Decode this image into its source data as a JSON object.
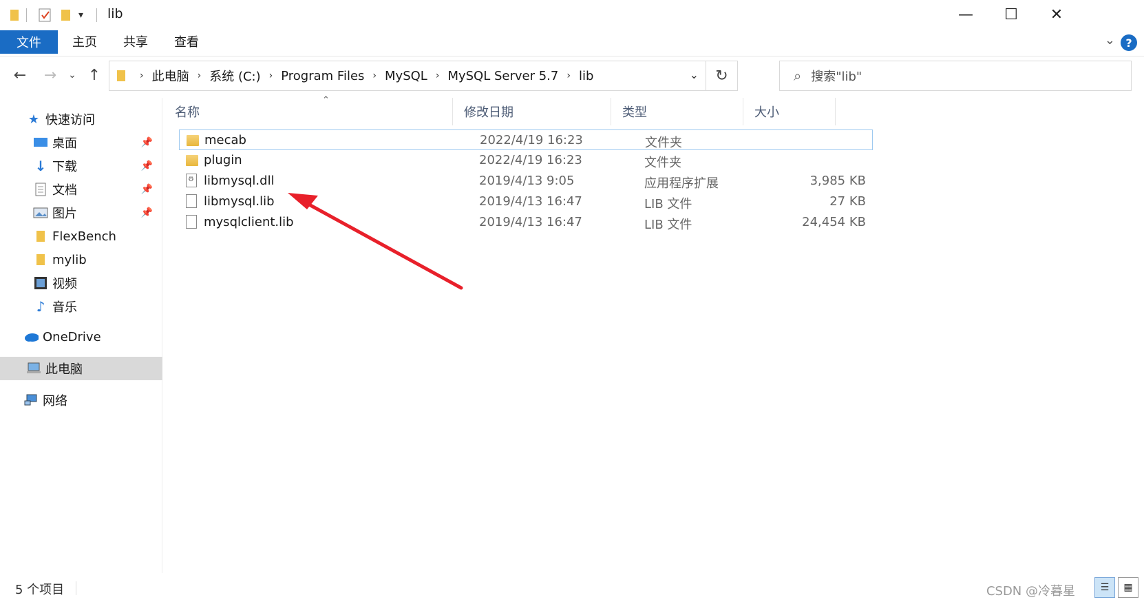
{
  "window": {
    "title": "lib",
    "controls": {
      "minimize": "—",
      "maximize": "☐",
      "close": "✕"
    }
  },
  "ribbon": {
    "tabs": [
      "文件",
      "主页",
      "共享",
      "查看"
    ],
    "help": "?"
  },
  "address": {
    "crumbs": [
      "此电脑",
      "系统 (C:)",
      "Program Files",
      "MySQL",
      "MySQL Server 5.7",
      "lib"
    ],
    "search_placeholder": "搜索\"lib\""
  },
  "sidebar": {
    "quick_access": "快速访问",
    "items": [
      {
        "label": "桌面",
        "icon": "desktop-icon",
        "pinned": true
      },
      {
        "label": "下载",
        "icon": "download-icon",
        "pinned": true
      },
      {
        "label": "文档",
        "icon": "document-icon",
        "pinned": true
      },
      {
        "label": "图片",
        "icon": "picture-icon",
        "pinned": true
      },
      {
        "label": "FlexBench",
        "icon": "folder-icon",
        "pinned": false
      },
      {
        "label": "mylib",
        "icon": "folder-icon",
        "pinned": false
      },
      {
        "label": "视频",
        "icon": "video-icon",
        "pinned": false
      },
      {
        "label": "音乐",
        "icon": "music-icon",
        "pinned": false
      }
    ],
    "onedrive": "OneDrive",
    "this_pc": "此电脑",
    "network": "网络"
  },
  "columns": {
    "name": "名称",
    "modified": "修改日期",
    "type": "类型",
    "size": "大小"
  },
  "files": [
    {
      "name": "mecab",
      "modified": "2022/4/19 16:23",
      "type": "文件夹",
      "size": "",
      "kind": "folder"
    },
    {
      "name": "plugin",
      "modified": "2022/4/19 16:23",
      "type": "文件夹",
      "size": "",
      "kind": "folder"
    },
    {
      "name": "libmysql.dll",
      "modified": "2019/4/13 9:05",
      "type": "应用程序扩展",
      "size": "3,985 KB",
      "kind": "dll"
    },
    {
      "name": "libmysql.lib",
      "modified": "2019/4/13 16:47",
      "type": "LIB 文件",
      "size": "27 KB",
      "kind": "file"
    },
    {
      "name": "mysqlclient.lib",
      "modified": "2019/4/13 16:47",
      "type": "LIB 文件",
      "size": "24,454 KB",
      "kind": "file"
    }
  ],
  "status": {
    "count": "5 个项目",
    "watermark": "CSDN @冷暮星"
  },
  "colors": {
    "accent": "#1a6cc4",
    "arrow": "#e8202a",
    "selection_border": "#9ec9f0"
  }
}
